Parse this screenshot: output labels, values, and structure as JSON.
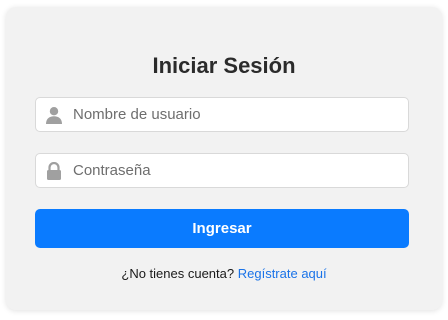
{
  "login": {
    "title": "Iniciar Sesión",
    "username": {
      "placeholder": "Nombre de usuario",
      "value": "",
      "icon": "user-icon"
    },
    "password": {
      "placeholder": "Contraseña",
      "value": "",
      "icon": "lock-icon"
    },
    "submit_label": "Ingresar",
    "register_prompt": "¿No tienes cuenta?",
    "register_link": "Regístrate aquí"
  },
  "colors": {
    "card_background": "#f2f2f2",
    "button": "#0a7bff",
    "link": "#1a73e8",
    "icon": "#a0a0a0"
  }
}
